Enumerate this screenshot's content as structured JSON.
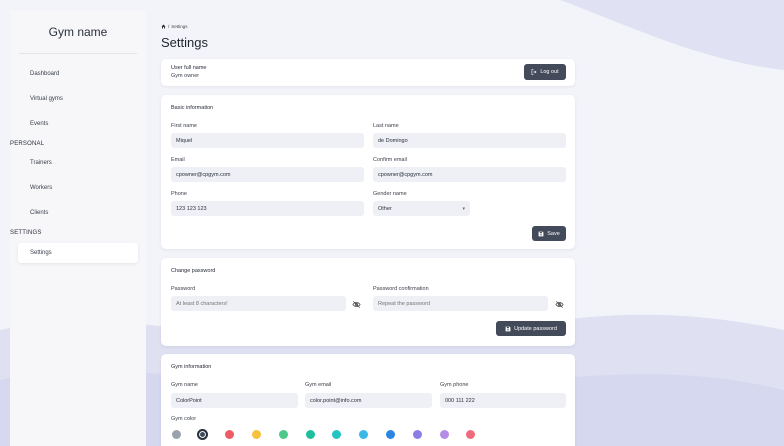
{
  "brand": "Gym name",
  "sidebar": {
    "items": [
      {
        "label": "Dashboard"
      },
      {
        "label": "Virtual gyms"
      },
      {
        "label": "Events"
      }
    ],
    "section_personal": "PERSONAL",
    "personal_items": [
      {
        "label": "Trainers"
      },
      {
        "label": "Workers"
      },
      {
        "label": "Clients"
      }
    ],
    "section_settings": "SETTINGS",
    "settings_items": [
      {
        "label": "Settings",
        "active": true
      }
    ]
  },
  "breadcrumb": {
    "home_icon": "home-icon",
    "separator": "/",
    "current": "Settings"
  },
  "page_title": "Settings",
  "user_card": {
    "name": "User full name",
    "role": "Gym owner",
    "logout_label": "Log out"
  },
  "basic_info": {
    "title": "Basic information",
    "first_name_label": "First name",
    "first_name_value": "Miquel",
    "last_name_label": "Last name",
    "last_name_value": "de Domingo",
    "email_label": "Email",
    "email_value": "cpowner@cpgym.com",
    "confirm_email_label": "Confirm email",
    "confirm_email_value": "cpowner@cpgym.com",
    "phone_label": "Phone",
    "phone_value": "123 123 123",
    "gender_label": "Gender name",
    "gender_value": "Other",
    "save_label": "Save"
  },
  "change_password": {
    "title": "Change password",
    "password_label": "Password",
    "password_placeholder": "At least 8 characters!",
    "confirm_label": "Password confirmation",
    "confirm_placeholder": "Repeat the password",
    "update_label": "Update password"
  },
  "gym_info": {
    "title": "Gym information",
    "gym_name_label": "Gym name",
    "gym_name_value": "ColorPoint",
    "gym_email_label": "Gym email",
    "gym_email_value": "color.point@info.com",
    "gym_phone_label": "Gym phone",
    "gym_phone_value": "000 111 222",
    "gym_color_label": "Gym color",
    "colors": [
      "#9aa3ad",
      "#3d4a5e",
      "#ee5a63",
      "#f6c23e",
      "#4cc98b",
      "#1fbf9e",
      "#22c4c4",
      "#3bb8e8",
      "#2a86e0",
      "#8a7ee6",
      "#b58be8",
      "#f06b7c"
    ],
    "selected_color_index": 1
  }
}
